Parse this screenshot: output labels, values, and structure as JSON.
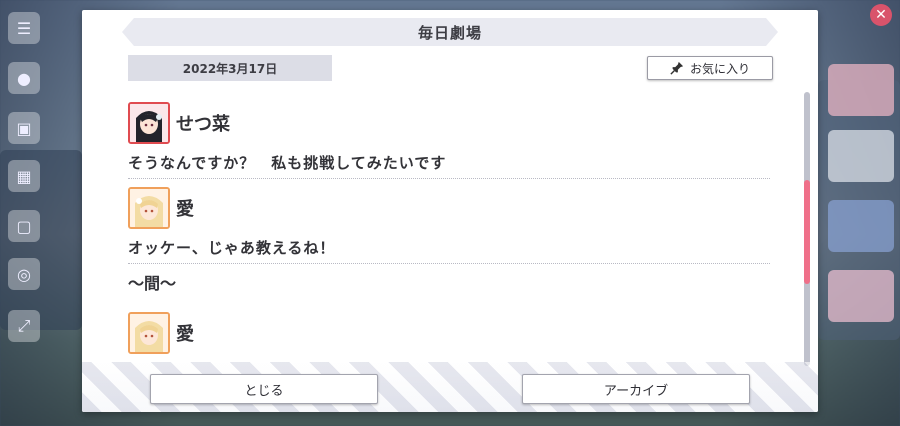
{
  "dialog": {
    "title": "毎日劇場",
    "date": "2022年3月17日",
    "favorite_label": "お気に入り",
    "close_label": "とじる",
    "archive_label": "アーカイブ"
  },
  "entries": [
    {
      "speaker": "せつ菜",
      "avatar": "avatar-setsuna",
      "line": "そうなんですか？　私も挑戦してみたいです"
    },
    {
      "speaker": "愛",
      "avatar": "avatar-ai",
      "line": "オッケー、じゃあ教えるね！"
    },
    {
      "narration": "〜間〜"
    },
    {
      "speaker": "愛",
      "avatar": "avatar-ai"
    }
  ],
  "colors": {
    "accent_scroll": "#ef6f89",
    "avatar_setsuna_border": "#e04b50",
    "avatar_ai_border": "#f0a05b"
  }
}
